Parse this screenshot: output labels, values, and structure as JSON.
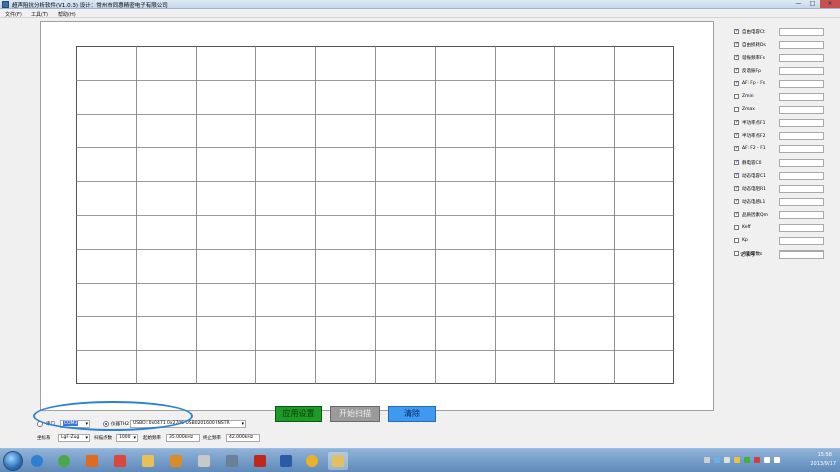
{
  "window": {
    "title": "超声阻抗分析软件(V1.0.3) 设计：常州市同惠精密电子有限公司",
    "min": "—",
    "max": "□",
    "close": "✕"
  },
  "menu": [
    "文件(F)",
    "工具(T)",
    "帮助(H)"
  ],
  "right_panel": {
    "items": [
      {
        "label": "自由电容Ct",
        "checked": true
      },
      {
        "label": "自由损耗Ds",
        "checked": true
      },
      {
        "label": "谐振频率Fs",
        "checked": true
      },
      {
        "label": "反谐振Fp",
        "checked": true
      },
      {
        "label": "ΔF: Fp - Fs",
        "checked": true
      },
      {
        "label": "Zmin",
        "checked": false
      },
      {
        "label": "Zmax",
        "checked": false
      },
      {
        "label": "半功率点F1",
        "checked": true
      },
      {
        "label": "半功率点F2",
        "checked": true
      },
      {
        "label": "ΔF: F2 - F1",
        "checked": true
      },
      {
        "label": "静电容C0",
        "checked": true
      },
      {
        "label": "动态电容C1",
        "checked": true
      },
      {
        "label": "动态电阻R1",
        "checked": true
      },
      {
        "label": "动态电感L1",
        "checked": true
      },
      {
        "label": "品质因素Qm",
        "checked": true
      },
      {
        "label": "Keff",
        "checked": false
      },
      {
        "label": "Kp",
        "checked": false
      },
      {
        "label": "介电常数ε",
        "checked": false
      }
    ],
    "record_label": "记录号"
  },
  "controls": {
    "port_label": "串口",
    "port_value": "COM3",
    "instrument_radio": "仪器TH2",
    "instrument_info": "USBO::0x0471  0x2706   USB0201600   INSTR",
    "coord_label": "坐标系",
    "coord_value": "LgF-Zug",
    "scan_points_label": "扫描点数",
    "scan_points_value": "1000",
    "start_freq_label": "起始频率",
    "start_freq_value": "35.000kHz",
    "stop_freq_label": "终止频率",
    "stop_freq_value": "42.000kHz",
    "apply_button": "应用设置",
    "scan_button": "开始扫描",
    "clear_button": "清除"
  },
  "taskbar": {
    "time": "15:58",
    "date": "2013/9/17"
  },
  "colors": {
    "apply": "#1e9a28",
    "scan": "#9a9a9a",
    "clear": "#3d9af0",
    "annotation": "#2e7fd6"
  },
  "grid": {
    "columns": 10,
    "rows": 10
  }
}
